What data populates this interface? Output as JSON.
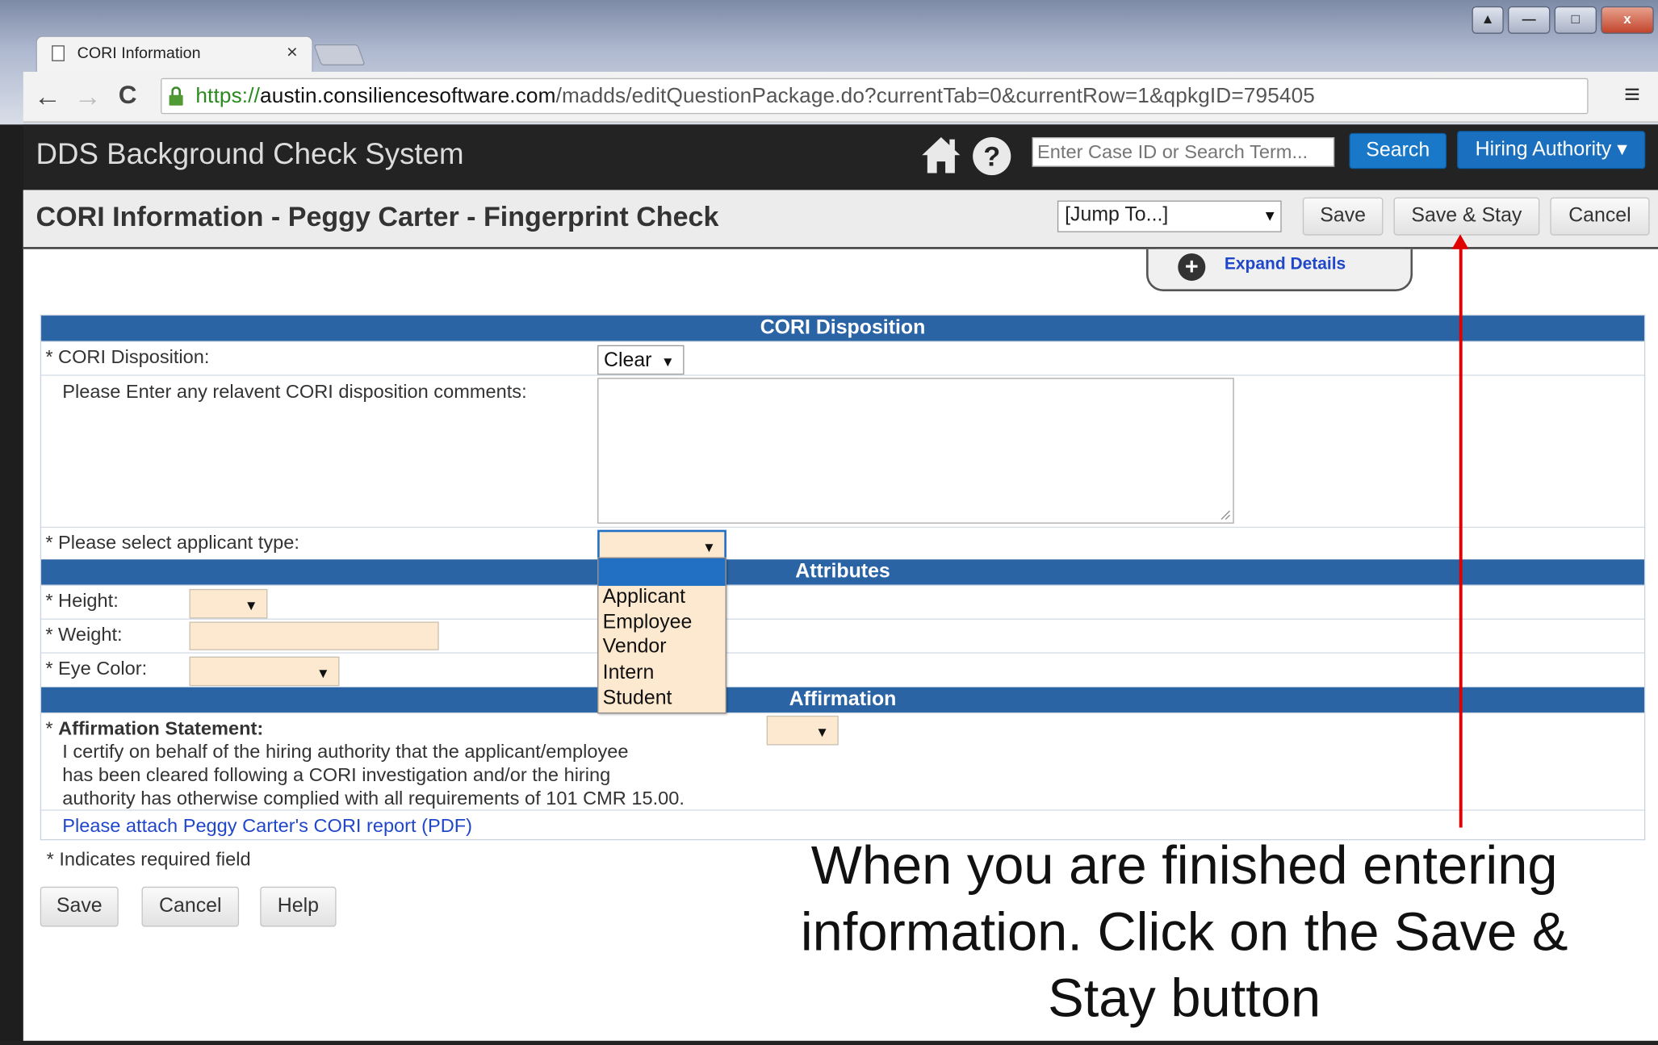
{
  "browser": {
    "tab_title": "CORI Information",
    "tab_close": "×",
    "url_scheme": "https://",
    "url_host": "austin.consiliencesoftware.com",
    "url_path": "/madds/editQuestionPackage.do?currentTab=0&currentRow=1&qpkgID=795405",
    "back": "←",
    "forward": "→",
    "reload": "C",
    "zoom": "⊕",
    "star": "☆",
    "menu": "≡",
    "window_user": "▲",
    "window_min": "—",
    "window_max": "□",
    "window_close": "x"
  },
  "app": {
    "title": "DDS Background Check System",
    "help": "?",
    "search_placeholder": "Enter Case ID or Search Term...",
    "search_button": "Search",
    "authority_button": "Hiring Authority ▾"
  },
  "page": {
    "title": "CORI Information - Peggy Carter - Fingerprint Check",
    "jump_to": "[Jump To...]",
    "save": "Save",
    "save_and_stay": "Save & Stay",
    "cancel": "Cancel",
    "expand_plus": "+",
    "expand_details": "Expand Details"
  },
  "form": {
    "section_disposition": "CORI Disposition",
    "label_disposition": "* CORI Disposition:",
    "disposition_value": "Clear",
    "label_comments": "Please Enter any relavent CORI disposition comments:",
    "label_applicant_type": "* Please select applicant type:",
    "section_attributes": "Attributes",
    "label_height": "* Height:",
    "label_weight": "* Weight:",
    "label_eye_color": "* Eye Color:",
    "section_affirmation": "Affirmation",
    "label_affirmation": "Affirmation Statement:",
    "affirmation_star": "* ",
    "affirmation_text_1": "I certify on behalf of the hiring authority that the applicant/employee",
    "affirmation_text_2": "has been cleared following a CORI investigation and/or the hiring",
    "affirmation_text_3": "authority has otherwise complied with all requirements of 101 CMR 15.00.",
    "attach_link": "Please attach Peggy Carter's CORI report (PDF)",
    "applicant_type_options": [
      "Applicant",
      "Employee",
      "Vendor",
      "Intern",
      "Student"
    ],
    "dropdown_arrow": "▼"
  },
  "footer": {
    "required_note": "* Indicates required field",
    "save": "Save",
    "cancel": "Cancel",
    "help": "Help"
  },
  "instruction": {
    "line1": "When you are finished entering",
    "line2": "information. Click on the Save &",
    "line3": "Stay button"
  },
  "colors": {
    "section_blue": "#2a64a4",
    "search_blue": "#1a78c8",
    "field_peach": "#fde9d0",
    "annotation_red": "#e00000"
  }
}
